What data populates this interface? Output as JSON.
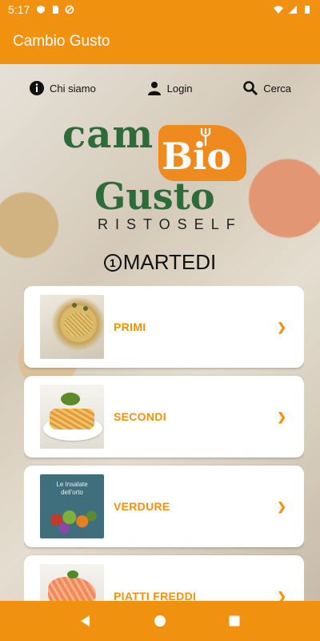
{
  "status_bar": {
    "time": "5:17"
  },
  "app_bar": {
    "title": "Cambio Gusto"
  },
  "top_links": [
    {
      "label": "Chi siamo",
      "icon": "info-icon"
    },
    {
      "label": "Login",
      "icon": "user-icon"
    },
    {
      "label": "Cerca",
      "icon": "search-icon"
    }
  ],
  "logo": {
    "line1": "cam",
    "line2": "Bio",
    "line3": "Gusto",
    "line4": "RISTOSELF"
  },
  "day": {
    "number": "1",
    "label": "MARTEDI"
  },
  "menu": [
    {
      "label": "PRIMI",
      "chevron": "❯"
    },
    {
      "label": "SECONDI",
      "chevron": "❯"
    },
    {
      "label": "VERDURE",
      "chevron": "❯",
      "thumb_text": "Le Insalate dell'orto"
    },
    {
      "label": "PIATTI FREDDI",
      "chevron": "❯"
    }
  ],
  "colors": {
    "accent": "#f0910f",
    "logo_green": "#2e6b3a",
    "logo_orange": "#ef8a1e"
  }
}
